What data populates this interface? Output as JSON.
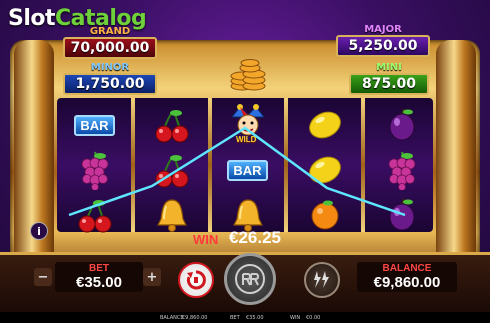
{
  "watermark": {
    "part1": "Slot",
    "part2": "Catalog"
  },
  "jackpots": {
    "grand": {
      "label": "GRAND",
      "value": "70,000.00"
    },
    "major": {
      "label": "MAJOR",
      "value": "5,250.00"
    },
    "minor": {
      "label": "MINOR",
      "value": "1,750.00"
    },
    "mini": {
      "label": "MINI",
      "value": "875.00"
    }
  },
  "reels": [
    [
      "bar",
      "fruit-cherries",
      "fruit-grapes",
      "fruit-cherries"
    ],
    [
      "fruit-cherries",
      "fruit-cherries",
      "bell"
    ],
    [
      "wild-jester",
      "bar",
      "bell"
    ],
    [
      "fruit-lemon",
      "fruit-lemon",
      "fruit-orange"
    ],
    [
      "fruit-plum",
      "fruit-grapes",
      "fruit-plum"
    ]
  ],
  "symbols": {
    "bar_label": "BAR",
    "wild_label": "WILD"
  },
  "win": {
    "label": "WIN",
    "value": "€26.25"
  },
  "bet": {
    "label": "BET",
    "value": "€35.00",
    "minus": "−",
    "plus": "+"
  },
  "balance": {
    "label": "BALANCE",
    "value": "€9,860.00"
  },
  "info_label": "i",
  "footer": {
    "balance_label": "BALANCE",
    "balance_value": "€9,860.00",
    "bet_label": "BET",
    "bet_value": "€35.00",
    "win_label": "WIN",
    "win_value": "€0.00"
  },
  "colors": {
    "winline": "#5fe6ff",
    "gold": "#e0b354",
    "win_red": "#ff3a3a"
  }
}
